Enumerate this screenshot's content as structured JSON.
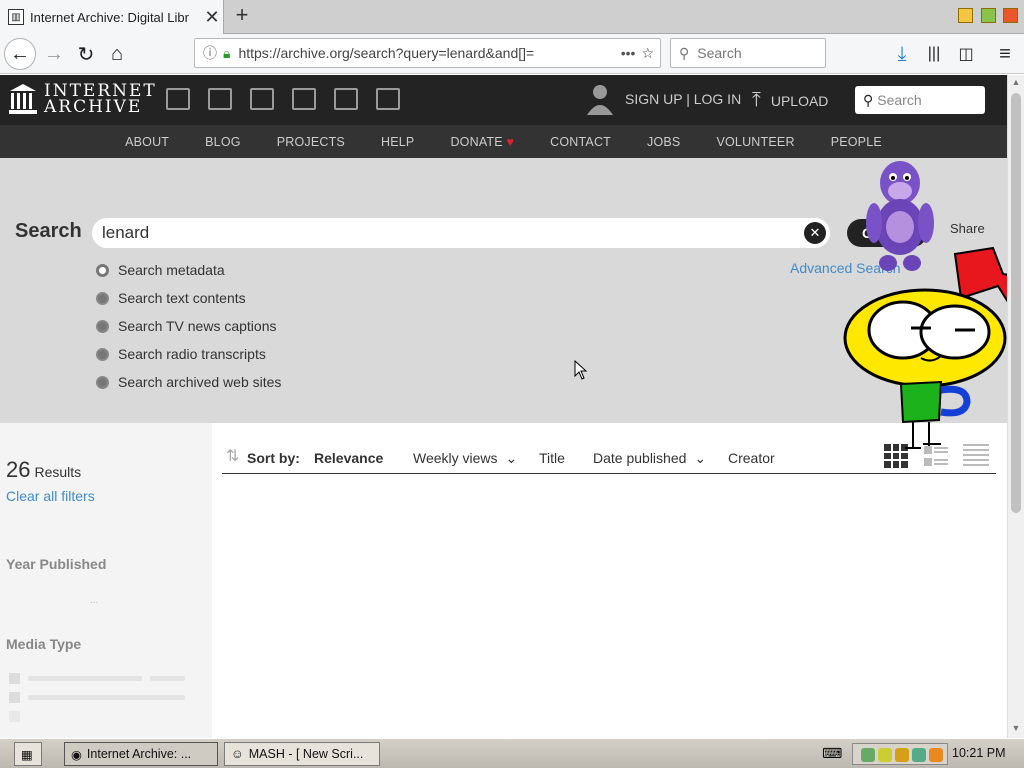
{
  "browser": {
    "tab_title": "Internet Archive: Digital Libr",
    "new_tab": "+",
    "url": "https://archive.org/search?query=lenard&and[]=",
    "search_placeholder": "Search"
  },
  "header": {
    "logo_line1": "INTERNET",
    "logo_line2": "ARCHIVE",
    "signup_login": "SIGN UP | LOG IN",
    "upload": "UPLOAD",
    "search_placeholder": "Search"
  },
  "nav": [
    "ABOUT",
    "BLOG",
    "PROJECTS",
    "HELP",
    "DONATE",
    "CONTACT",
    "JOBS",
    "VOLUNTEER",
    "PEOPLE"
  ],
  "search": {
    "label": "Search",
    "query": "lenard",
    "go": "GO",
    "share": "Share",
    "advanced": "Advanced Search",
    "options": [
      "Search metadata",
      "Search text contents",
      "Search TV news captions",
      "Search radio transcripts",
      "Search archived web sites"
    ]
  },
  "results": {
    "count": "26",
    "count_label": "Results",
    "clear_filters": "Clear all filters",
    "facet_year": "Year Published",
    "facet_media": "Media Type",
    "year_placeholder": "..."
  },
  "sort": {
    "label": "Sort by:",
    "relevance": "Relevance",
    "weekly": "Weekly views",
    "title": "Title",
    "date": "Date published",
    "creator": "Creator"
  },
  "taskbar": {
    "task1": "Internet Archive: ...",
    "task2": "MASH - [ New Scri...",
    "clock": "10:21 PM"
  },
  "colors": {
    "ia_header": "#232323",
    "ia_nav": "#333333",
    "link": "#428bca",
    "donate_heart": "#e0222b"
  }
}
